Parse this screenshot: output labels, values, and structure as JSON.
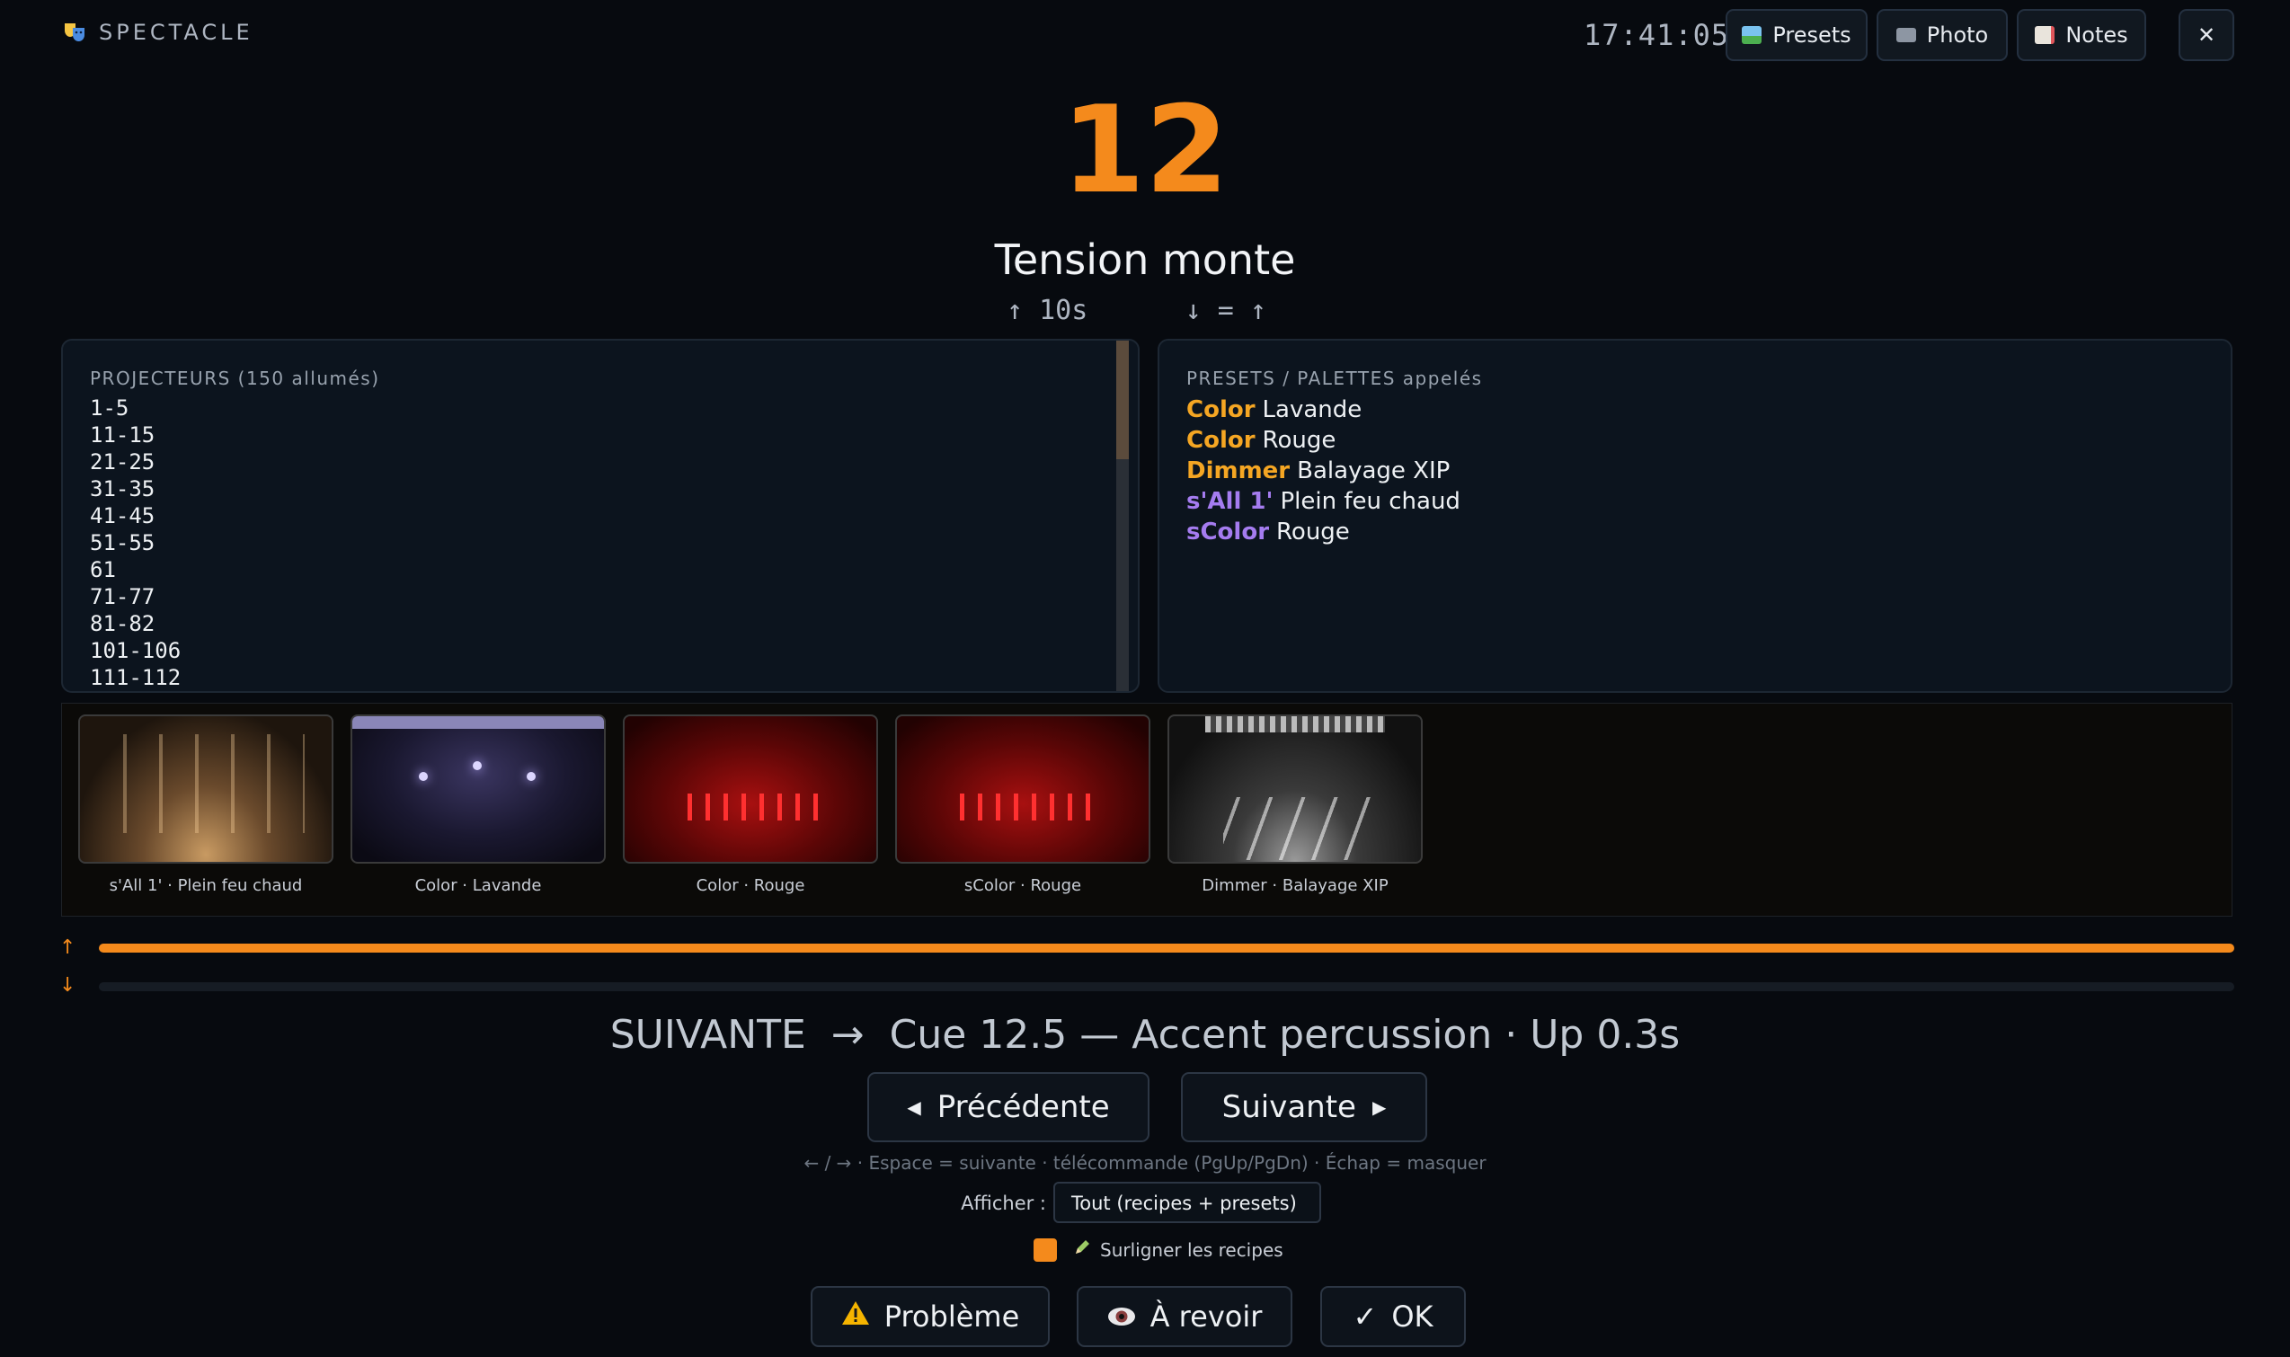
{
  "header": {
    "brand": "SPECTACLE",
    "clock": "17:41:05",
    "buttons": {
      "presets": "Presets",
      "photo": "Photo",
      "notes": "Notes",
      "close": "✕"
    }
  },
  "cue": {
    "number": "12",
    "name": "Tension monte",
    "timing": "↑ 10s      ↓ = ↑"
  },
  "fixtures": {
    "title": "PROJECTEURS (150 allumés)",
    "items": [
      "1-5",
      "11-15",
      "21-25",
      "31-35",
      "41-45",
      "51-55",
      "61",
      "71-77",
      "81-82",
      "101-106",
      "111-112"
    ]
  },
  "presets": {
    "title": "PRESETS / PALETTES appelés",
    "items": [
      {
        "kind": "Color",
        "name": "Lavande",
        "color": "#f5a623"
      },
      {
        "kind": "Color",
        "name": "Rouge",
        "color": "#f5a623"
      },
      {
        "kind": "Dimmer",
        "name": "Balayage XIP",
        "color": "#f5a623"
      },
      {
        "kind": "s'All 1'",
        "name": "Plein feu chaud",
        "color": "#a57cf0"
      },
      {
        "kind": "sColor",
        "name": "Rouge",
        "color": "#a57cf0"
      }
    ]
  },
  "thumbnails": [
    {
      "label": "s'All 1' · Plein feu chaud"
    },
    {
      "label": "Color · Lavande"
    },
    {
      "label": "Color · Rouge"
    },
    {
      "label": "sColor · Rouge"
    },
    {
      "label": "Dimmer · Balayage XIP"
    }
  ],
  "fades": {
    "up_label": "↑",
    "down_label": "↓",
    "up_progress": 1.0,
    "down_progress": 0.0
  },
  "next": {
    "line": "SUIVANTE  →  Cue 12.5 — Accent percussion · Up 0.3s"
  },
  "nav": {
    "prev": "Précédente",
    "next": "Suivante",
    "hint": "← / →  ·  Espace = suivante  ·  télécommande (PgUp/PgDn)  ·  Échap = masquer"
  },
  "filter": {
    "label": "Afficher :",
    "value": "Tout (recipes + presets)"
  },
  "highlight": {
    "label": "Surligner les recipes",
    "checked": true
  },
  "actions": {
    "problem": "Problème",
    "review": "À revoir",
    "ok": "OK"
  },
  "colors": {
    "accent": "#f48a1c",
    "background": "#070a0f",
    "preset_kind": "#f5a623",
    "submaster_kind": "#a57cf0"
  }
}
